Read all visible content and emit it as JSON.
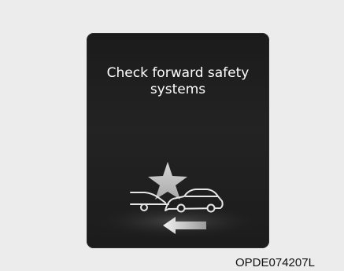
{
  "display": {
    "message_line1": "Check forward safety",
    "message_line2": "systems",
    "icons": [
      "collision-star-icon",
      "own-car-icon",
      "front-car-icon",
      "left-arrow-icon"
    ]
  },
  "colors": {
    "page_background": "#ececec",
    "panel_background": "#1f1f1f",
    "text": "#ffffff",
    "icon_fill": "#bdbdbd"
  },
  "caption": {
    "code": "OPDE074207L"
  }
}
